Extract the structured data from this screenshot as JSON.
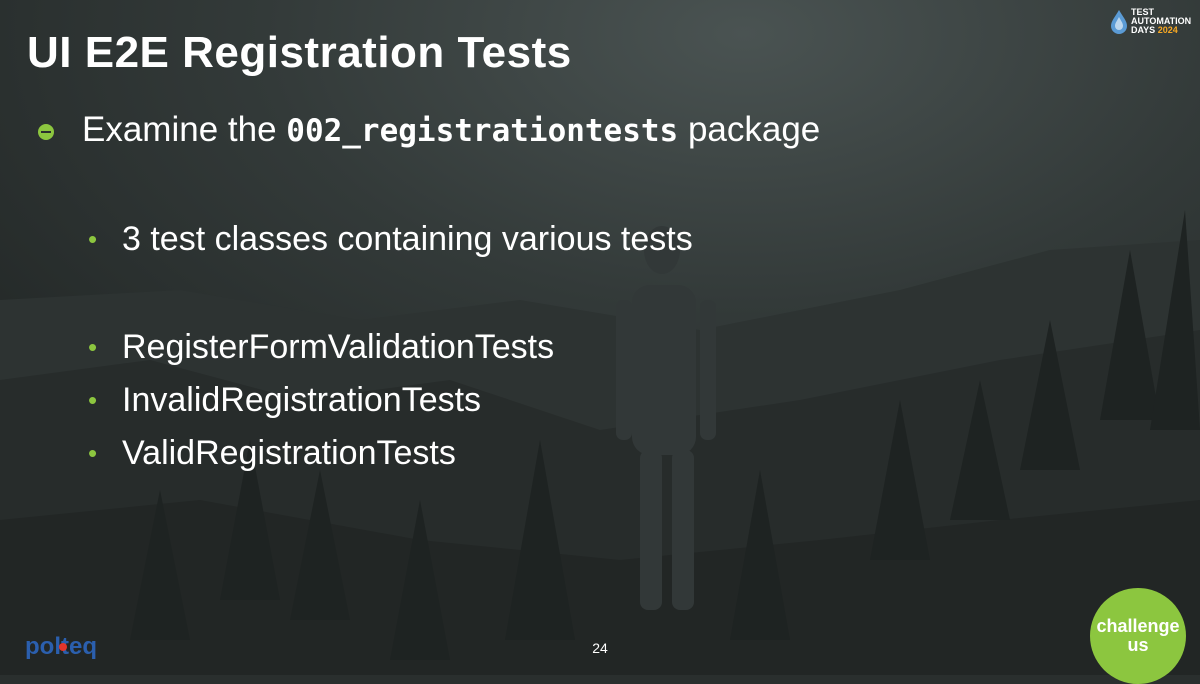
{
  "slide": {
    "title": "UI E2E Registration Tests",
    "main_bullet": {
      "prefix": "Examine the ",
      "code": "002_registrationtests",
      "suffix": " package"
    },
    "sub_bullets": [
      "3 test classes containing various tests",
      "RegisterFormValidationTests",
      "InvalidRegistrationTests",
      "ValidRegistrationTests"
    ],
    "page_number": "24"
  },
  "logos": {
    "tad": {
      "line1": "TEST",
      "line2": "AUTOMATION",
      "line3": "DAYS",
      "year": "2024"
    },
    "polteq": "polteq",
    "challenge": {
      "line1": "challenge",
      "line2": "us"
    }
  },
  "colors": {
    "accent": "#8cc63f",
    "text": "#ffffff",
    "background": "#2a2f2e",
    "tad_year": "#f7a823",
    "polteq_blue": "#2b5fae",
    "polteq_red": "#e2352b"
  }
}
